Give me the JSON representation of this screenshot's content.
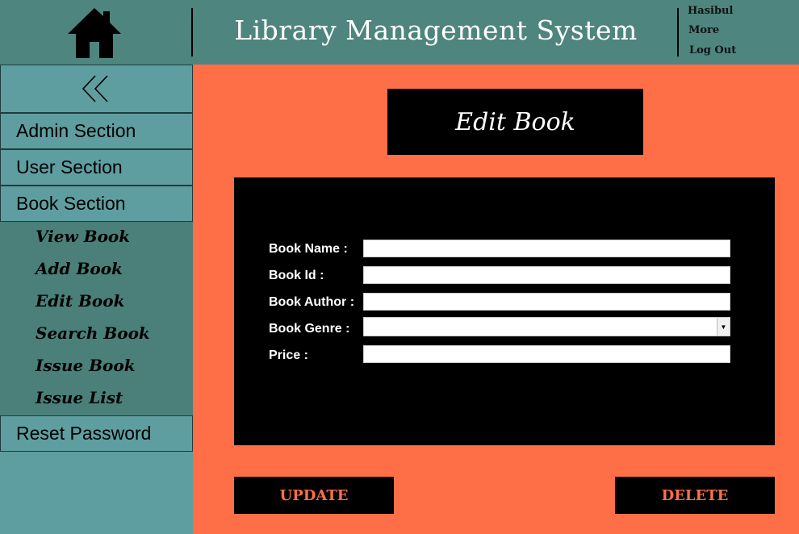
{
  "header": {
    "title": "Library Management System",
    "links": [
      "Hasibul",
      "More",
      "Log Out"
    ]
  },
  "sidebar": {
    "collapse_icon": "double-chevron-left-icon",
    "sections": [
      "Admin Section",
      "User Section",
      "Book Section"
    ],
    "book_items": [
      "View Book",
      "Add Book",
      "Edit Book",
      "Search Book",
      "Issue Book",
      "Issue List"
    ],
    "reset": "Reset Password"
  },
  "main": {
    "title": "Edit Book",
    "fields": [
      {
        "label": "Book Name :",
        "value": ""
      },
      {
        "label": "Book Id :",
        "value": ""
      },
      {
        "label": "Book Author :",
        "value": ""
      },
      {
        "label": "Book Genre :",
        "value": ""
      },
      {
        "label": "Price :",
        "value": ""
      }
    ],
    "update_label": "UPDATE",
    "delete_label": "DELETE"
  },
  "colors": {
    "header_bg": "#4e857e",
    "sidebar_bg": "#5f9ea0",
    "submenu_bg": "#4a8079",
    "main_bg": "#ff6f47",
    "panel_bg": "#000000"
  }
}
